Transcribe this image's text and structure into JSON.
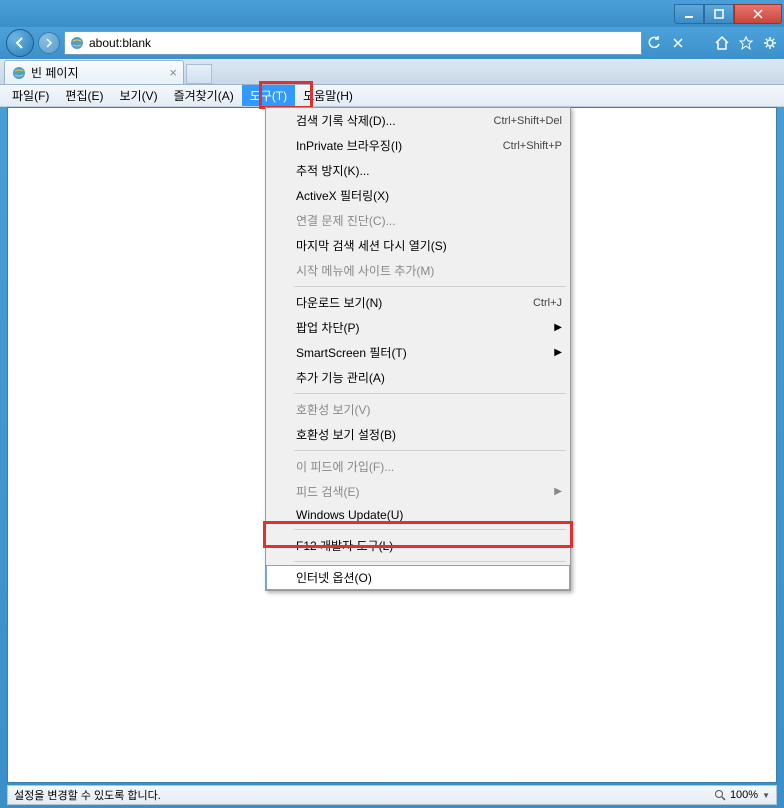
{
  "titlebar": {
    "min_title": "최소화",
    "max_title": "최대화",
    "close_title": "닫기"
  },
  "navbar": {
    "url": "about:blank",
    "refresh_title": "새로 고침",
    "stop_title": "중지"
  },
  "tabs": {
    "active": {
      "title": "빈 페이지"
    }
  },
  "menubar": {
    "items": [
      "파일(F)",
      "편집(E)",
      "보기(V)",
      "즐겨찾기(A)",
      "도구(T)",
      "도움말(H)"
    ]
  },
  "dropdown": {
    "items": [
      {
        "label": "검색 기록 삭제(D)...",
        "shortcut": "Ctrl+Shift+Del",
        "enabled": true
      },
      {
        "label": "InPrivate 브라우징(I)",
        "shortcut": "Ctrl+Shift+P",
        "enabled": true
      },
      {
        "label": "추적 방지(K)...",
        "enabled": true
      },
      {
        "label": "ActiveX 필터링(X)",
        "enabled": true
      },
      {
        "label": "연결 문제 진단(C)...",
        "enabled": false
      },
      {
        "label": "마지막 검색 세션 다시 열기(S)",
        "enabled": true
      },
      {
        "label": "시작 메뉴에 사이트 추가(M)",
        "enabled": false
      },
      {
        "sep": true
      },
      {
        "label": "다운로드 보기(N)",
        "shortcut": "Ctrl+J",
        "enabled": true
      },
      {
        "label": "팝업 차단(P)",
        "submenu": true,
        "enabled": true
      },
      {
        "label": "SmartScreen 필터(T)",
        "submenu": true,
        "enabled": true
      },
      {
        "label": "추가 기능 관리(A)",
        "enabled": true
      },
      {
        "sep": true
      },
      {
        "label": "호환성 보기(V)",
        "enabled": false
      },
      {
        "label": "호환성 보기 설정(B)",
        "enabled": true
      },
      {
        "sep": true
      },
      {
        "label": "이 피드에 가입(F)...",
        "enabled": false
      },
      {
        "label": "피드 검색(E)",
        "submenu": true,
        "enabled": false
      },
      {
        "label": "Windows Update(U)",
        "enabled": true
      },
      {
        "sep": true
      },
      {
        "label": "F12 개발자 도구(L)",
        "enabled": true
      },
      {
        "sep": true
      },
      {
        "label": "인터넷 옵션(O)",
        "enabled": true,
        "highlighted": true
      }
    ]
  },
  "statusbar": {
    "text": "설정을 변경할 수 있도록 합니다.",
    "zoom": "100%"
  }
}
